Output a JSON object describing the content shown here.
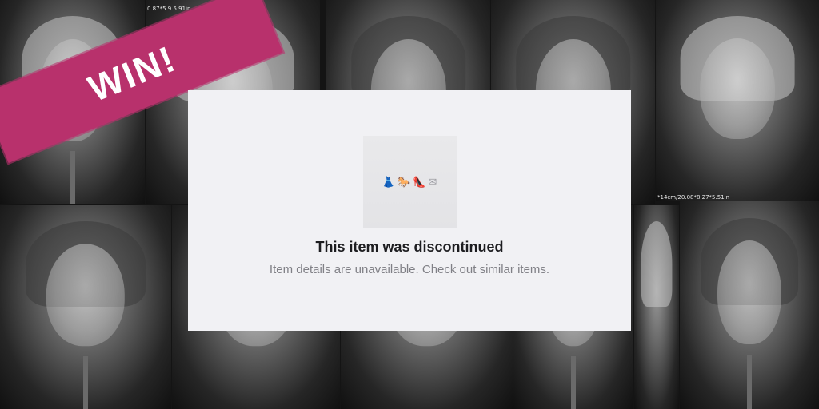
{
  "background": {
    "tiles": [
      {
        "id": "tile-1",
        "variant": "light"
      },
      {
        "id": "tile-2",
        "variant": "light"
      },
      {
        "id": "tile-3",
        "variant": "dark"
      },
      {
        "id": "tile-4",
        "variant": "dark"
      },
      {
        "id": "tile-5",
        "variant": "light"
      },
      {
        "id": "tile-6",
        "variant": "dark"
      },
      {
        "id": "tile-7",
        "variant": "light"
      },
      {
        "id": "tile-8",
        "variant": "light"
      },
      {
        "id": "tile-9",
        "variant": "dark"
      },
      {
        "id": "tile-10",
        "variant": "light"
      },
      {
        "id": "tile-11",
        "variant": "dark"
      }
    ],
    "size_labels": {
      "top": "0.87*5.9 5.91in",
      "right": "*14cm/20.08*8.27*5.51in"
    }
  },
  "banner": {
    "text": "WIN!",
    "color": "#b8316c"
  },
  "modal": {
    "placeholder_icons": [
      "dress-icon",
      "rocking-horse-icon",
      "high-heel-icon",
      "envelope-icon"
    ],
    "title": "This item was discontinued",
    "subtitle": "Item details are unavailable. Check out similar items."
  }
}
